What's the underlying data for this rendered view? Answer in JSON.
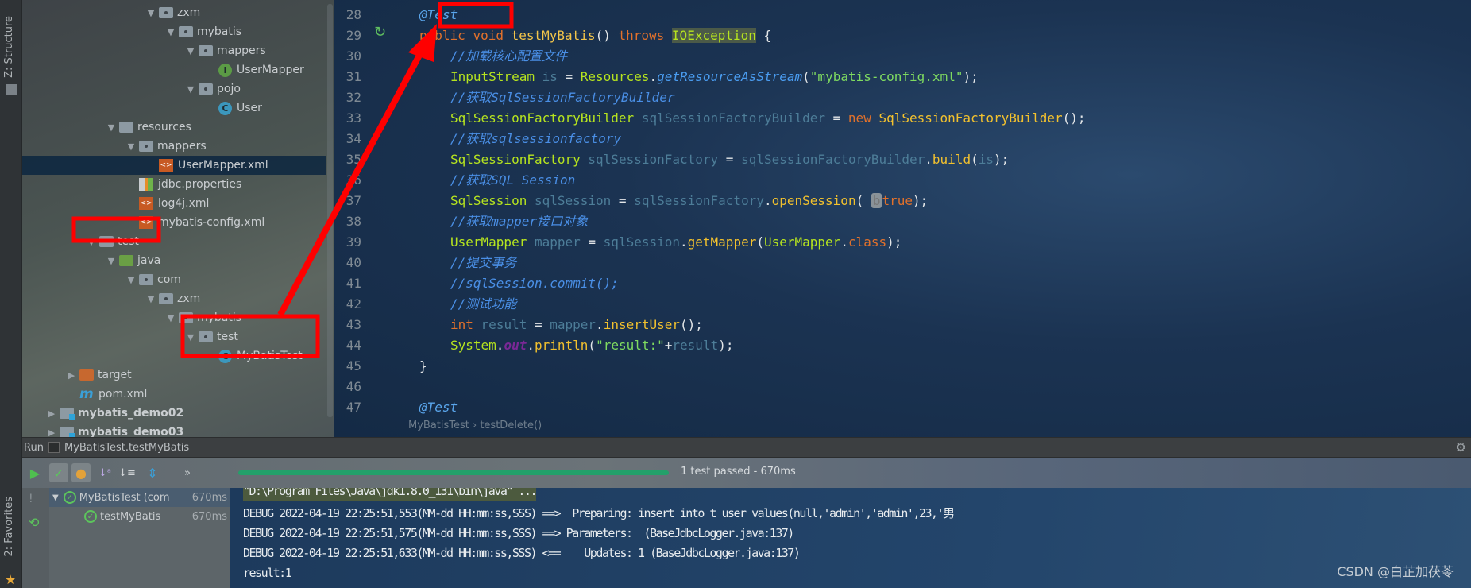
{
  "sidebar": {
    "structure_label": "Z: Structure",
    "favorites_label": "2: Favorites"
  },
  "project_tree": [
    {
      "label": "zxm",
      "level": 5,
      "icon": "folder",
      "expanded": true
    },
    {
      "label": "mybatis",
      "level": 6,
      "icon": "folder",
      "expanded": true
    },
    {
      "label": "mappers",
      "level": 7,
      "icon": "folder",
      "expanded": true
    },
    {
      "label": "UserMapper",
      "level": 8,
      "icon": "interface"
    },
    {
      "label": "pojo",
      "level": 7,
      "icon": "folder",
      "expanded": true
    },
    {
      "label": "User",
      "level": 8,
      "icon": "class"
    },
    {
      "label": "resources",
      "level": 3,
      "icon": "resources",
      "expanded": true
    },
    {
      "label": "mappers",
      "level": 4,
      "icon": "folder",
      "expanded": true
    },
    {
      "label": "UserMapper.xml",
      "level": 5,
      "icon": "xml",
      "selected": true
    },
    {
      "label": "jdbc.properties",
      "level": 4,
      "icon": "properties"
    },
    {
      "label": "log4j.xml",
      "level": 4,
      "icon": "xml"
    },
    {
      "label": "mybatis-config.xml",
      "level": 4,
      "icon": "xml"
    },
    {
      "label": "test",
      "level": 2,
      "icon": "folder-plain",
      "expanded": true
    },
    {
      "label": "java",
      "level": 3,
      "icon": "source",
      "expanded": true
    },
    {
      "label": "com",
      "level": 4,
      "icon": "folder",
      "expanded": true
    },
    {
      "label": "zxm",
      "level": 5,
      "icon": "folder",
      "expanded": true
    },
    {
      "label": "mybatis",
      "level": 6,
      "icon": "folder",
      "expanded": true
    },
    {
      "label": "test",
      "level": 7,
      "icon": "folder",
      "expanded": true
    },
    {
      "label": "MyBatisTest",
      "level": 8,
      "icon": "class"
    },
    {
      "label": "target",
      "level": 1,
      "icon": "target",
      "expanded": false
    },
    {
      "label": "pom.xml",
      "level": 1,
      "icon": "maven"
    },
    {
      "label": "mybatis_demo02",
      "level": 0,
      "icon": "module",
      "expanded": false,
      "bold": true
    },
    {
      "label": "mybatis_demo03",
      "level": 0,
      "icon": "module",
      "expanded": false,
      "bold": true
    }
  ],
  "editor": {
    "lines": [
      {
        "n": "28",
        "indent": 0,
        "tokens": [
          [
            "@Test",
            "annotation"
          ]
        ]
      },
      {
        "n": "29",
        "indent": 0,
        "tokens": [
          [
            "public",
            "keyword"
          ],
          [
            " ",
            "plain"
          ],
          [
            "void",
            "keyword"
          ],
          [
            " ",
            "plain"
          ],
          [
            "testMyBatis",
            "method-decl"
          ],
          [
            "() ",
            "plain"
          ],
          [
            "throws",
            "keyword"
          ],
          [
            " ",
            "plain"
          ],
          [
            "IOException",
            "type-hl"
          ],
          [
            " {",
            "plain"
          ]
        ]
      },
      {
        "n": "30",
        "indent": 1,
        "tokens": [
          [
            "//加载核心配置文件",
            "comment"
          ]
        ]
      },
      {
        "n": "31",
        "indent": 1,
        "tokens": [
          [
            "InputStream",
            "type"
          ],
          [
            " ",
            "plain"
          ],
          [
            "is",
            "var"
          ],
          [
            " = ",
            "plain"
          ],
          [
            "Resources",
            "type"
          ],
          [
            ".",
            "plain"
          ],
          [
            "getResourceAsStream",
            "static"
          ],
          [
            "(",
            "plain"
          ],
          [
            "\"mybatis-config.xml\"",
            "string"
          ],
          [
            ");",
            "plain"
          ]
        ]
      },
      {
        "n": "32",
        "indent": 1,
        "tokens": [
          [
            "//获取SqlSessionFactoryBuilder",
            "comment"
          ]
        ]
      },
      {
        "n": "33",
        "indent": 1,
        "tokens": [
          [
            "SqlSessionFactoryBuilder",
            "type"
          ],
          [
            " ",
            "plain"
          ],
          [
            "sqlSessionFactoryBuilder",
            "var"
          ],
          [
            " = ",
            "plain"
          ],
          [
            "new",
            "keyword"
          ],
          [
            " ",
            "plain"
          ],
          [
            "SqlSessionFactoryBuilder",
            "call"
          ],
          [
            "();",
            "plain"
          ]
        ]
      },
      {
        "n": "34",
        "indent": 1,
        "tokens": [
          [
            "//获取sqlsessionfactory",
            "comment"
          ]
        ]
      },
      {
        "n": "35",
        "indent": 1,
        "tokens": [
          [
            "SqlSessionFactory",
            "type"
          ],
          [
            " ",
            "plain"
          ],
          [
            "sqlSessionFactory",
            "var"
          ],
          [
            " = ",
            "plain"
          ],
          [
            "sqlSessionFactoryBuilder",
            "var"
          ],
          [
            ".",
            "plain"
          ],
          [
            "build",
            "call"
          ],
          [
            "(",
            "plain"
          ],
          [
            "is",
            "var"
          ],
          [
            ");",
            "plain"
          ]
        ]
      },
      {
        "n": "36",
        "indent": 1,
        "tokens": [
          [
            "//获取SQL Session",
            "comment"
          ]
        ]
      },
      {
        "n": "37",
        "indent": 1,
        "tokens": [
          [
            "SqlSession",
            "type"
          ],
          [
            " ",
            "plain"
          ],
          [
            "sqlSession",
            "var"
          ],
          [
            " = ",
            "plain"
          ],
          [
            "sqlSessionFactory",
            "var"
          ],
          [
            ".",
            "plain"
          ],
          [
            "openSession",
            "call"
          ],
          [
            "( ",
            "plain"
          ],
          [
            "b",
            "hint"
          ],
          [
            "true",
            "keyword"
          ],
          [
            ");",
            "plain"
          ]
        ]
      },
      {
        "n": "38",
        "indent": 1,
        "tokens": [
          [
            "//获取mapper接口对象",
            "comment"
          ]
        ]
      },
      {
        "n": "39",
        "indent": 1,
        "tokens": [
          [
            "UserMapper",
            "type"
          ],
          [
            " ",
            "plain"
          ],
          [
            "mapper",
            "var"
          ],
          [
            " = ",
            "plain"
          ],
          [
            "sqlSession",
            "var"
          ],
          [
            ".",
            "plain"
          ],
          [
            "getMapper",
            "call"
          ],
          [
            "(",
            "plain"
          ],
          [
            "UserMapper",
            "type"
          ],
          [
            ".",
            "plain"
          ],
          [
            "class",
            "keyword"
          ],
          [
            ");",
            "plain"
          ]
        ]
      },
      {
        "n": "40",
        "indent": 1,
        "tokens": [
          [
            "//提交事务",
            "comment"
          ]
        ]
      },
      {
        "n": "41",
        "indent": 1,
        "tokens": [
          [
            "//sqlSession.commit();",
            "comment"
          ]
        ]
      },
      {
        "n": "42",
        "indent": 1,
        "tokens": [
          [
            "//测试功能",
            "comment"
          ]
        ]
      },
      {
        "n": "43",
        "indent": 1,
        "tokens": [
          [
            "int",
            "keyword"
          ],
          [
            " ",
            "plain"
          ],
          [
            "result",
            "var"
          ],
          [
            " = ",
            "plain"
          ],
          [
            "mapper",
            "var"
          ],
          [
            ".",
            "plain"
          ],
          [
            "insertUser",
            "call"
          ],
          [
            "();",
            "plain"
          ]
        ]
      },
      {
        "n": "44",
        "indent": 1,
        "tokens": [
          [
            "System",
            "type"
          ],
          [
            ".",
            "plain"
          ],
          [
            "out",
            "field"
          ],
          [
            ".",
            "plain"
          ],
          [
            "println",
            "call"
          ],
          [
            "(",
            "plain"
          ],
          [
            "\"result:\"",
            "string"
          ],
          [
            "+",
            "plain"
          ],
          [
            "result",
            "var"
          ],
          [
            ");",
            "plain"
          ]
        ]
      },
      {
        "n": "45",
        "indent": 0,
        "tokens": [
          [
            "}",
            "plain"
          ]
        ]
      },
      {
        "n": "46",
        "indent": 0,
        "tokens": []
      },
      {
        "n": "47",
        "indent": 0,
        "tokens": [
          [
            "@Test",
            "annotation"
          ]
        ]
      }
    ],
    "breadcrumb": "MyBatisTest  ›  testDelete()"
  },
  "run": {
    "tab_label": "Run",
    "config_name": "MyBatisTest.testMyBatis",
    "progress_percent": 100,
    "status": "1 test passed - 670ms",
    "tree": [
      {
        "label": "MyBatisTest (com",
        "time": "670ms"
      },
      {
        "label": "testMyBatis",
        "time": "670ms"
      }
    ],
    "console": [
      "\"D:\\Program Files\\Java\\jdk1.8.0_131\\bin\\java\" ...",
      "DEBUG 2022-04-19 22:25:51,553(MM-dd HH:mm:ss,SSS) ==>  Preparing: insert into t_user values(null,'admin','admin',23,'男",
      "DEBUG 2022-04-19 22:25:51,575(MM-dd HH:mm:ss,SSS) ==> Parameters:  (BaseJdbcLogger.java:137)",
      "DEBUG 2022-04-19 22:25:51,633(MM-dd HH:mm:ss,SSS) <==    Updates: 1 (BaseJdbcLogger.java:137)",
      "result:1"
    ]
  },
  "watermark": "CSDN @白芷加茯苓",
  "colors": {
    "annotation_box": "#ff0000",
    "progress": "#23a06a"
  }
}
